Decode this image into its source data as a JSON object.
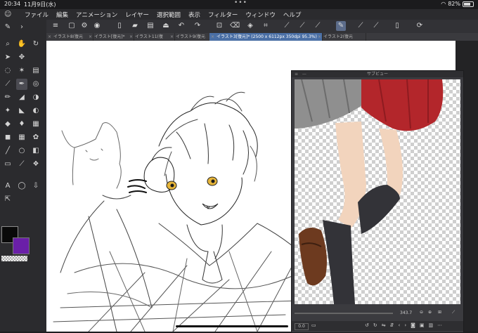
{
  "statusbar": {
    "time": "20:34",
    "date": "11月9日(水)",
    "battery": "82%"
  },
  "menubar": {
    "items": [
      "ファイル",
      "編集",
      "アニメーション",
      "レイヤー",
      "選択範囲",
      "表示",
      "フィルター",
      "ウィンドウ",
      "ヘルプ"
    ]
  },
  "tabs": [
    {
      "label": "イラスト8(復元"
    },
    {
      "label": "イラスト[復元]*"
    },
    {
      "label": "イラスト11(復"
    },
    {
      "label": "イラスト9(復元"
    },
    {
      "label": "イラスト3[復元]* (2500 x 6112px 350dpi 95.3%)",
      "active": true
    },
    {
      "label": "イラスト2(復元"
    }
  ],
  "subview": {
    "title": "サブビュー",
    "zoom": "343.7",
    "angle": "0.0"
  },
  "colors": {
    "main": "#090909",
    "sub": "#6a1fa8",
    "accent": "#4a6fa5"
  }
}
